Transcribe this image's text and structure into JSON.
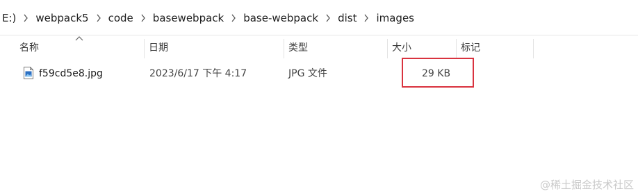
{
  "breadcrumb": {
    "items": [
      "E:)",
      "webpack5",
      "code",
      "basewebpack",
      "base-webpack",
      "dist",
      "images"
    ]
  },
  "columns": {
    "name": "名称",
    "date": "日期",
    "type": "类型",
    "size": "大小",
    "tags": "标记",
    "sort_indicator": "ascending"
  },
  "files": [
    {
      "name": "f59cd5e8.jpg",
      "date": "2023/6/17 下午 4:17",
      "type": "JPG 文件",
      "size": "29 KB",
      "icon": "image-file-icon"
    }
  ],
  "annotation": {
    "highlight_color": "#d9333f"
  },
  "watermark": "@稀土掘金技术社区"
}
